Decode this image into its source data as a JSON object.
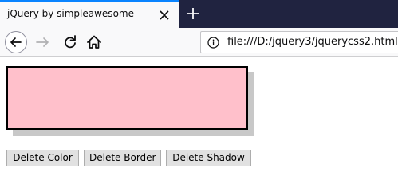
{
  "browser": {
    "tab_title": "jQuery by simpleawesome",
    "url": "file:///D:/jquery3/jquerycss2.html",
    "icons": {
      "tab_close": "close-icon",
      "new_tab": "plus-icon",
      "back": "arrow-left-icon",
      "forward": "arrow-right-icon",
      "reload": "reload-icon",
      "home": "home-icon",
      "site_info": "info-icon"
    }
  },
  "page": {
    "box": {
      "background_color": "#ffc0cb",
      "border_color": "#000000",
      "shadow_color": "#c8c8c8"
    },
    "buttons": {
      "delete_color": "Delete Color",
      "delete_border": "Delete Border",
      "delete_shadow": "Delete Shadow"
    }
  },
  "colors": {
    "tabstrip": "#202340",
    "tab_accent": "#0a84ff",
    "toolbar": "#f9f9fa"
  }
}
